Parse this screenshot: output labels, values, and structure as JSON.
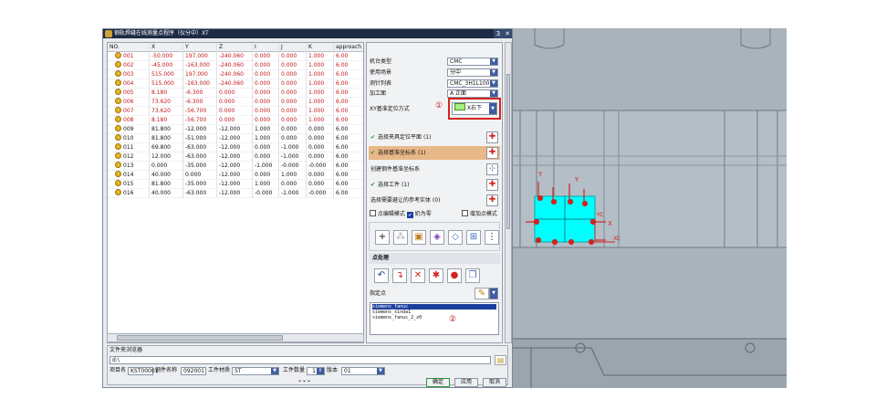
{
  "dialog": {
    "title": "钢轨焊缝在线测量点程序（仪分中）XT",
    "close_glyph": "✕",
    "help_glyph": "3"
  },
  "grid": {
    "headers": [
      "NO.",
      "X",
      "Y",
      "Z",
      "I",
      "J",
      "K",
      "approach"
    ],
    "rows": [
      {
        "no": "001",
        "x": "-50.000",
        "y": "197.000",
        "z": "-240.060",
        "i": "0.000",
        "j": "0.000",
        "k": "1.000",
        "a": "6.00",
        "red": true
      },
      {
        "no": "002",
        "x": "-45.000",
        "y": "-163.000",
        "z": "-240.060",
        "i": "0.000",
        "j": "0.000",
        "k": "1.000",
        "a": "6.00",
        "red": true
      },
      {
        "no": "003",
        "x": "515.000",
        "y": "197.000",
        "z": "-240.060",
        "i": "0.000",
        "j": "0.000",
        "k": "1.000",
        "a": "6.00",
        "red": true
      },
      {
        "no": "004",
        "x": "515.000",
        "y": "-163.000",
        "z": "-240.060",
        "i": "0.000",
        "j": "0.000",
        "k": "1.000",
        "a": "6.00",
        "red": true
      },
      {
        "no": "005",
        "x": "8.180",
        "y": "-6.300",
        "z": "0.000",
        "i": "0.000",
        "j": "0.000",
        "k": "1.000",
        "a": "6.00",
        "red": true
      },
      {
        "no": "006",
        "x": "73.620",
        "y": "-6.300",
        "z": "0.000",
        "i": "0.000",
        "j": "0.000",
        "k": "1.000",
        "a": "6.00",
        "red": true
      },
      {
        "no": "007",
        "x": "73.620",
        "y": "-56.700",
        "z": "0.000",
        "i": "0.000",
        "j": "0.000",
        "k": "1.000",
        "a": "6.00",
        "red": true
      },
      {
        "no": "008",
        "x": "8.180",
        "y": "-56.700",
        "z": "0.000",
        "i": "0.000",
        "j": "0.000",
        "k": "1.000",
        "a": "6.00",
        "red": true
      },
      {
        "no": "009",
        "x": "81.800",
        "y": "-12.000",
        "z": "-12.000",
        "i": "1.000",
        "j": "0.000",
        "k": "0.000",
        "a": "6.00",
        "red": false
      },
      {
        "no": "010",
        "x": "81.800",
        "y": "-51.000",
        "z": "-12.000",
        "i": "1.000",
        "j": "0.000",
        "k": "0.000",
        "a": "6.00",
        "red": false
      },
      {
        "no": "011",
        "x": "69.800",
        "y": "-63.000",
        "z": "-12.000",
        "i": "0.000",
        "j": "-1.000",
        "k": "0.000",
        "a": "6.00",
        "red": false
      },
      {
        "no": "012",
        "x": "12.000",
        "y": "-63.000",
        "z": "-12.000",
        "i": "0.000",
        "j": "-1.000",
        "k": "0.000",
        "a": "6.00",
        "red": false
      },
      {
        "no": "013",
        "x": "0.000",
        "y": "-35.000",
        "z": "-12.000",
        "i": "-1.000",
        "j": "-0.000",
        "k": "-0.000",
        "a": "6.00",
        "red": false
      },
      {
        "no": "014",
        "x": "40.000",
        "y": "0.000",
        "z": "-12.000",
        "i": "0.000",
        "j": "1.000",
        "k": "0.000",
        "a": "6.00",
        "red": false
      },
      {
        "no": "015",
        "x": "81.800",
        "y": "-35.000",
        "z": "-12.000",
        "i": "1.000",
        "j": "0.000",
        "k": "0.000",
        "a": "6.00",
        "red": false
      },
      {
        "no": "016",
        "x": "40.000",
        "y": "-63.000",
        "z": "-12.000",
        "i": "-0.000",
        "j": "-1.000",
        "k": "-0.000",
        "a": "6.00",
        "red": false
      }
    ]
  },
  "panel": {
    "machine_type_label": "机台类型",
    "machine_type_value": "CMC",
    "scene_label": "使用场景",
    "scene_value": "分中",
    "probe_list_label": "测针列表",
    "probe_list_value": "CMC_3H1L100",
    "face_label": "加工面",
    "face_value": "A 正面",
    "xy_label": "XY基准定位方式",
    "xy_value": "X右下",
    "select_plane": "选择夹具定位平面 (1)",
    "select_csys": "选择基准坐标系 (1)",
    "create_csys": "创建钢件基准坐标系",
    "select_workpiece": "选择工件 (1)",
    "select_avoid": "选择需要避让的参考实体 (0)",
    "edit_mode": "点编辑模式",
    "is_electrode": "奶为零",
    "add_mode": "增加点模式",
    "point_section": "点处理",
    "specify_point": "指定点",
    "post_list": [
      "siemens_fanuc",
      "siemens_xinda1",
      "siemens_fanuc_2_z0"
    ],
    "marker1": "①",
    "marker2": "②"
  },
  "file_browser": {
    "section": "文件夹浏览器",
    "path": "d:\\",
    "project_label": "项目名",
    "project_value": "KST00001",
    "part_label": "钢件名称",
    "part_value": "092001",
    "material_label": "工件材质",
    "material_value": "ST",
    "qty_label": "工件数量",
    "qty_value": "1",
    "version_label": "版本",
    "version_value": "01",
    "expand": "⌄⌄⌄"
  },
  "buttons": {
    "ok": "确定",
    "apply": "应用",
    "cancel": "取消"
  },
  "viewport": {
    "axis_x": "XC",
    "axis_y": "Y",
    "axis_z": "X",
    "axis_yc": "YC",
    "background": "#a8b3bc",
    "accent": "#00ffff"
  }
}
